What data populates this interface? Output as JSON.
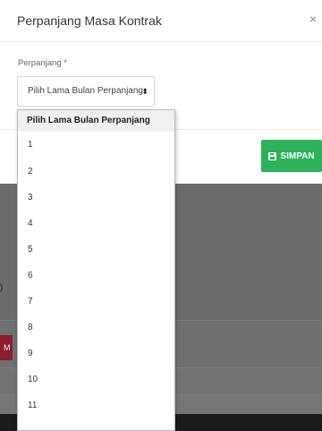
{
  "modal": {
    "title": "Perpanjang Masa Kontrak",
    "close_label": "×",
    "field_label": "Perpanjang *",
    "select_value": "Pilih Lama Bulan Perpanjang",
    "save_label": "SIMPAN"
  },
  "dropdown": {
    "header": "Pilih Lama Bulan Perpanjang",
    "options": [
      "1",
      "2",
      "3",
      "4",
      "5",
      "6",
      "7",
      "8",
      "9",
      "10",
      "11"
    ]
  },
  "background": {
    "fragment_text": ")",
    "badge_text": "M"
  },
  "colors": {
    "save_button": "#2cb35a",
    "badge": "#8b1f2a",
    "overlay": "#6b6b6b"
  },
  "icons": {
    "save": "floppy-disk-icon",
    "close": "close-icon",
    "select": "sort-arrows-icon"
  }
}
